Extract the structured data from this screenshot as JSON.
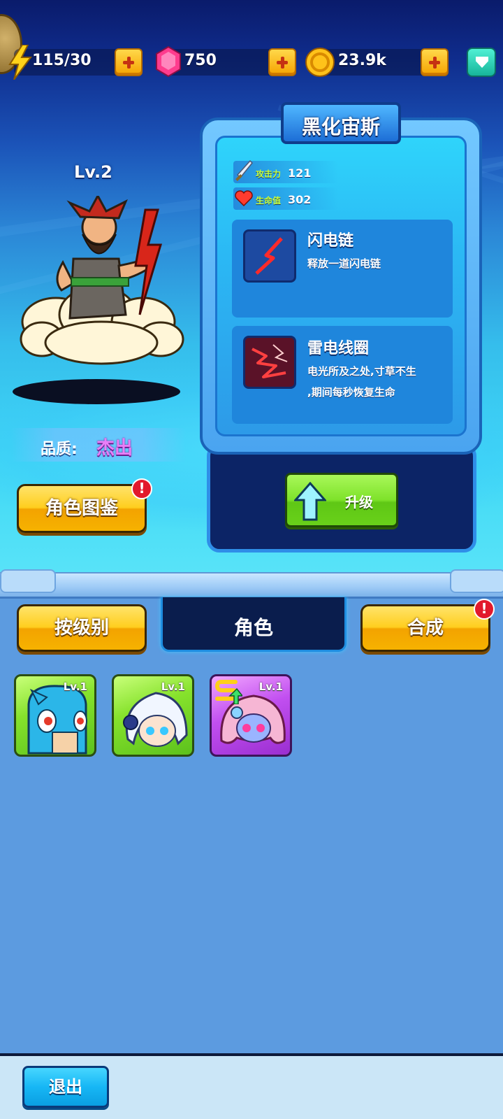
{
  "resources": {
    "energy": "115/30",
    "gems": "750",
    "gold": "23.9k"
  },
  "hero": {
    "level": "Lv.2",
    "quality_label": "品质:",
    "quality_value": "杰出"
  },
  "card": {
    "name": "黑化宙斯",
    "stats": [
      {
        "label": "攻击力",
        "value": "121",
        "icon": "sword-icon"
      },
      {
        "label": "生命值",
        "value": "302",
        "icon": "heart-icon"
      }
    ],
    "skills": [
      {
        "name": "闪电链",
        "desc_lines": [
          "释放一道闪电链"
        ],
        "icon": "lightning-icon"
      },
      {
        "name": "雷电线圈",
        "desc_lines": [
          "电光所及之处,寸草不生",
          ",期间每秒恢复生命"
        ],
        "icon": "thunder-coil-icon"
      }
    ],
    "upgrade_label": "升级"
  },
  "buttons": {
    "codex": "角色图鉴",
    "sort_by_level": "按级别",
    "merge": "合成",
    "exit": "退出"
  },
  "tabs": {
    "active": "角色"
  },
  "badges": {
    "alert": "!"
  },
  "characters": [
    {
      "level": "Lv.1",
      "rarity": "green"
    },
    {
      "level": "Lv.1",
      "rarity": "green"
    },
    {
      "level": "Lv.1",
      "rarity": "purple"
    }
  ],
  "colors": {
    "quality": "#e87ff7",
    "stat_label": "#c8ff3a",
    "accent_yellow": "#ffce1e",
    "upgrade_green": "#7ee22a"
  }
}
